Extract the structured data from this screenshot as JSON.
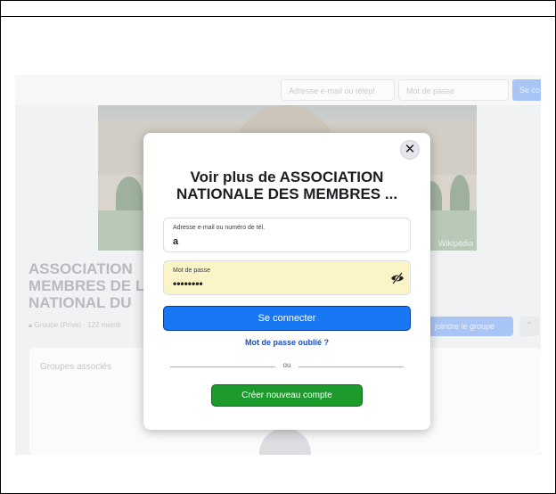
{
  "background_page": {
    "email_placeholder": "Adresse e-mail ou télép!",
    "password_placeholder": "Mot de passe",
    "login_label": "Se co",
    "cover_credit": "Wikipédia",
    "group_title": "ASSOCIATION MEMBRES DE L NATIONAL DU",
    "group_title_lines": [
      "ASSOCIATION",
      "MEMBRES DE L",
      "NATIONAL DU"
    ],
    "group_meta": "Groupe (Privé) · 122 memb",
    "join_label": "joindre le groupe",
    "more_label": "⌃",
    "associated_groups": "Groupes associés"
  },
  "modal": {
    "close_glyph": "✕",
    "title_line1": "Voir plus de ASSOCIATION",
    "title_line2": "NATIONALE DES MEMBRES ...",
    "email_label": "Adresse e-mail ou numéro de tél.",
    "email_value": "a",
    "password_label": "Mot de passe",
    "password_value": "••••••••",
    "login_button": "Se connecter",
    "forgot_link": "Mot de passe oublié ?",
    "divider_text": "ou",
    "create_button": "Créer nouveau compte"
  },
  "colors": {
    "primary": "#1877f2",
    "create": "#1c9a2b",
    "password_bg": "#fbf4c6"
  },
  "icons": {
    "close": "close-icon",
    "password_visibility": "eye-slash-icon"
  }
}
